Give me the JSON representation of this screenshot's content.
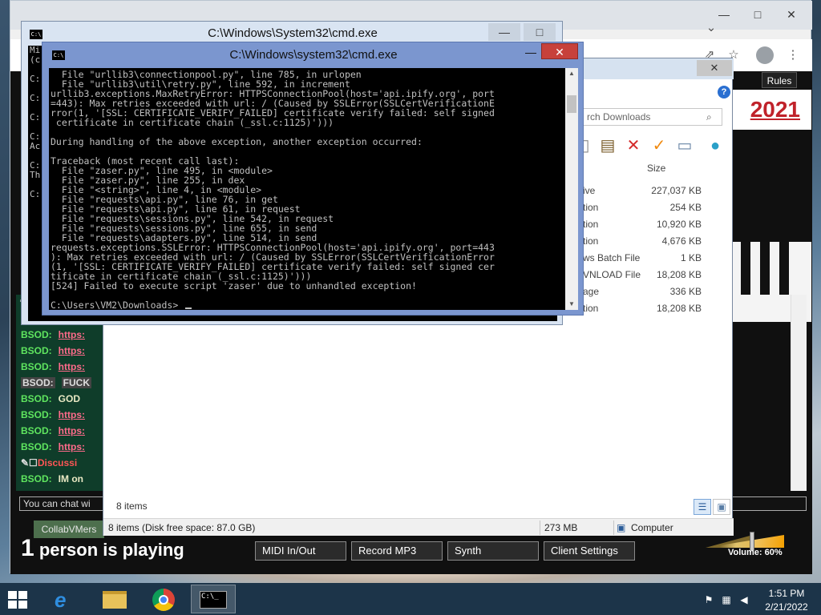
{
  "browser": {
    "rules_label": "Rules",
    "year_text": "2021",
    "players_count": "1",
    "players_text": "person is playing",
    "buttons": [
      "MIDI In/Out",
      "Record MP3",
      "Synth",
      "Client Settings"
    ],
    "volume_label": "Volume: 60%",
    "volume_level": 0.6,
    "chat_input_placeholder": "You can chat wi",
    "tab_label": "CollabVMers",
    "chat_rows": [
      {
        "name": "BSOD:",
        "text": "https:",
        "kind": "link"
      },
      {
        "name": "BSOD:",
        "text": "https:",
        "kind": "link"
      },
      {
        "name": "BSOD:",
        "text": "https:",
        "kind": "link"
      },
      {
        "name": "BSOD:",
        "text": "https:",
        "kind": "link"
      },
      {
        "name": "BSOD:",
        "text": "FUCK",
        "kind": "dim"
      },
      {
        "name": "BSOD:",
        "text": "GOD",
        "kind": "plain"
      },
      {
        "name": "BSOD:",
        "text": "https:",
        "kind": "link"
      },
      {
        "name": "BSOD:",
        "text": "https:",
        "kind": "link"
      },
      {
        "name": "BSOD:",
        "text": "https:",
        "kind": "link"
      },
      {
        "name": "",
        "text": "Discussi",
        "kind": "discuss"
      },
      {
        "name": "BSOD:",
        "text": "IM on",
        "kind": "plain"
      }
    ]
  },
  "explorer": {
    "search_placeholder": "rch Downloads",
    "col_size": "Size",
    "files": [
      {
        "type": "ive",
        "size": "227,037 KB"
      },
      {
        "type": "tion",
        "size": "254 KB"
      },
      {
        "type": "tion",
        "size": "10,920 KB"
      },
      {
        "type": "tion",
        "size": "4,676 KB"
      },
      {
        "type": "ws Batch File",
        "size": "1 KB"
      },
      {
        "type": "VNLOAD File",
        "size": "18,208 KB"
      },
      {
        "type": "age",
        "size": "336 KB"
      },
      {
        "type": "tion",
        "size": "18,208 KB"
      }
    ],
    "items_count": "8 items",
    "status_items": "8 items (Disk free space: 87.0 GB)",
    "status_size": "273 MB",
    "status_location": "Computer"
  },
  "cmd_back": {
    "title": "C:\\Windows\\System32\\cmd.exe",
    "lines": [
      "Mi",
      "(c",
      "",
      "C:",
      "",
      "C:",
      "",
      "C:",
      "",
      "C:",
      "Ac",
      "",
      "C:",
      "Th",
      "",
      "C:"
    ]
  },
  "cmd_front": {
    "title": "C:\\Windows\\system32\\cmd.exe",
    "icon_text": "C:\\",
    "lines": [
      "  File \"urllib3\\connectionpool.py\", line 785, in urlopen",
      "  File \"urllib3\\util\\retry.py\", line 592, in increment",
      "urllib3.exceptions.MaxRetryError: HTTPSConnectionPool(host='api.ipify.org', port",
      "=443): Max retries exceeded with url: / (Caused by SSLError(SSLCertVerificationE",
      "rror(1, '[SSL: CERTIFICATE_VERIFY_FAILED] certificate verify failed: self signed",
      " certificate in certificate chain (_ssl.c:1125)')))",
      "",
      "During handling of the above exception, another exception occurred:",
      "",
      "Traceback (most recent call last):",
      "  File \"zaser.py\", line 495, in <module>",
      "  File \"zaser.py\", line 255, in dex",
      "  File \"<string>\", line 4, in <module>",
      "  File \"requests\\api.py\", line 76, in get",
      "  File \"requests\\api.py\", line 61, in request",
      "  File \"requests\\sessions.py\", line 542, in request",
      "  File \"requests\\sessions.py\", line 655, in send",
      "  File \"requests\\adapters.py\", line 514, in send",
      "requests.exceptions.SSLError: HTTPSConnectionPool(host='api.ipify.org', port=443",
      "): Max retries exceeded with url: / (Caused by SSLError(SSLCertVerificationError",
      "(1, '[SSL: CERTIFICATE_VERIFY_FAILED] certificate verify failed: self signed cer",
      "tificate in certificate chain (_ssl.c:1125)')))",
      "[524] Failed to execute script 'zaser' due to unhandled exception!",
      "",
      "C:\\Users\\VM2\\Downloads>"
    ],
    "close_symbol": "✕",
    "min_symbol": "—",
    "max_symbol": "□"
  },
  "taskbar": {
    "time": "1:51 PM",
    "date": "2/21/2022",
    "cmd_icon_text": "C:\\_"
  },
  "colors": {
    "cmd_close": "#c7413b",
    "chat_green": "#5fe55f",
    "chat_link": "#ff6b8b",
    "taskbar": "#1c3449"
  }
}
